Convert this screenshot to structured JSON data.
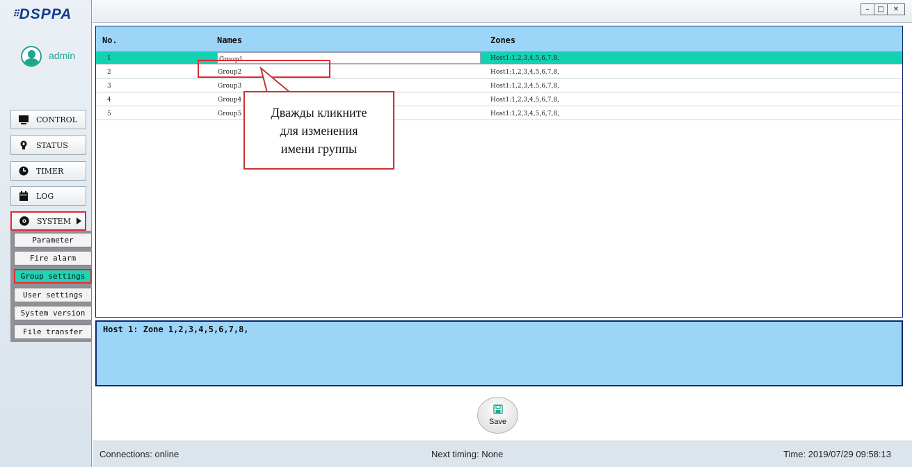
{
  "brand": {
    "logo_text": "DSPPA",
    "logo_dots": "⠿"
  },
  "user": {
    "name": "admin"
  },
  "nav": {
    "control": "CONTROL",
    "status": "STATUS",
    "timer": "TIMER",
    "log": "LOG",
    "system": "SYSTEM"
  },
  "submenu": {
    "items": [
      "Parameter",
      "Fire alarm",
      "Group settings",
      "User settings",
      "System version",
      "File transfer"
    ]
  },
  "window_controls": {
    "minimize": "–",
    "maximize": "□",
    "close": "✕"
  },
  "table": {
    "headers": {
      "no": "No.",
      "names": "Names",
      "zones": "Zones"
    },
    "rows": [
      {
        "no": "1",
        "name": "Group1",
        "zones": "Host1:1,2,3,4,5,6,7,8,"
      },
      {
        "no": "2",
        "name": "Group2",
        "zones": "Host1:1,2,3,4,5,6,7,8,"
      },
      {
        "no": "3",
        "name": "Group3",
        "zones": "Host1:1,2,3,4,5,6,7,8,"
      },
      {
        "no": "4",
        "name": "Group4",
        "zones": "Host1:1,2,3,4,5,6,7,8,"
      },
      {
        "no": "5",
        "name": "Group5",
        "zones": "Host1:1,2,3,4,5,6,7,8,"
      }
    ]
  },
  "detail": {
    "text": "Host 1: Zone 1,2,3,4,5,6,7,8,"
  },
  "save": {
    "label": "Save"
  },
  "status": {
    "connections": "Connections: online",
    "next_timing": "Next timing: None",
    "time": "Time: 2019/07/29  09:58:13"
  },
  "annotation": {
    "lines": [
      "Дважды кликните",
      "для изменения",
      "имени группы"
    ]
  },
  "colors": {
    "accent_teal": "#13d2b2",
    "header_blue": "#9cd5f7",
    "highlight_red": "#e8262f"
  }
}
